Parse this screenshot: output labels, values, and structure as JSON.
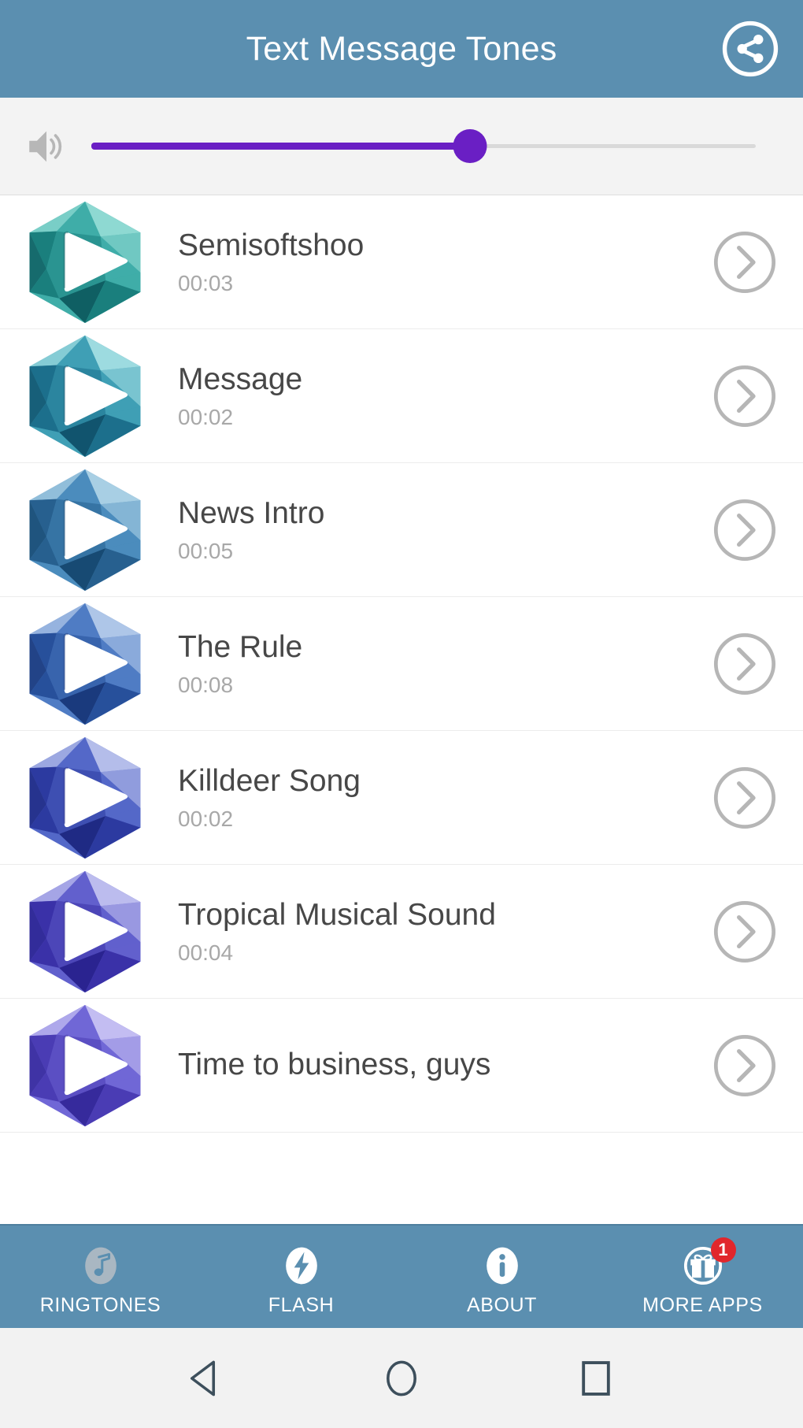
{
  "header": {
    "title": "Text Message Tones",
    "background_color": "#5b8fb0",
    "share_icon": "share-icon"
  },
  "volume": {
    "speaker_icon": "volume-speaker-icon",
    "value_percent": 57,
    "fill_color": "#6a1fc4",
    "track_color": "#d9d9d9"
  },
  "tones": [
    {
      "title": "Semisoftshoo",
      "duration": "00:03",
      "icon": "play-gem-icon",
      "gem_light": "#8ed9d2",
      "gem_mid": "#3fada8",
      "gem_dark": "#1a7f7d",
      "gem_deep": "#0f5f63"
    },
    {
      "title": "Message",
      "duration": "00:02",
      "icon": "play-gem-icon",
      "gem_light": "#9ddbe0",
      "gem_mid": "#3f9fb5",
      "gem_dark": "#1c6f8c",
      "gem_deep": "#11546e"
    },
    {
      "title": "News Intro",
      "duration": "00:05",
      "icon": "play-gem-icon",
      "gem_light": "#a8cfe4",
      "gem_mid": "#4b8cbd",
      "gem_dark": "#27608f",
      "gem_deep": "#174a73"
    },
    {
      "title": "The Rule",
      "duration": "00:08",
      "icon": "play-gem-icon",
      "gem_light": "#aec6e8",
      "gem_mid": "#4f7cc4",
      "gem_dark": "#27509b",
      "gem_deep": "#1a3a7d"
    },
    {
      "title": "Killdeer Song",
      "duration": "00:02",
      "icon": "play-gem-icon",
      "gem_light": "#b4bdea",
      "gem_mid": "#5468c8",
      "gem_dark": "#2c3aa0",
      "gem_deep": "#1f2a84"
    },
    {
      "title": "Tropical Musical Sound",
      "duration": "00:04",
      "icon": "play-gem-icon",
      "gem_light": "#bcbcee",
      "gem_mid": "#6260cd",
      "gem_dark": "#3a31a8",
      "gem_deep": "#2a2390"
    },
    {
      "title": "Time to business, guys",
      "duration": "",
      "icon": "play-gem-icon",
      "gem_light": "#c3bdf2",
      "gem_mid": "#7067d6",
      "gem_dark": "#4a3cb4",
      "gem_deep": "#362a9c"
    }
  ],
  "row_action_icon": "chevron-right-circle-icon",
  "bottom_nav": [
    {
      "label": "RINGTONES",
      "icon": "music-note-icon",
      "active": true,
      "badge": ""
    },
    {
      "label": "FLASH",
      "icon": "lightning-bolt-icon",
      "active": false,
      "badge": ""
    },
    {
      "label": "ABOUT",
      "icon": "info-icon",
      "active": false,
      "badge": ""
    },
    {
      "label": "MORE APPS",
      "icon": "gift-icon",
      "active": false,
      "badge": "1"
    }
  ],
  "system_nav": [
    {
      "name": "back-button",
      "icon": "triangle-back-icon"
    },
    {
      "name": "home-button",
      "icon": "circle-home-icon"
    },
    {
      "name": "recents-button",
      "icon": "square-recents-icon"
    }
  ]
}
